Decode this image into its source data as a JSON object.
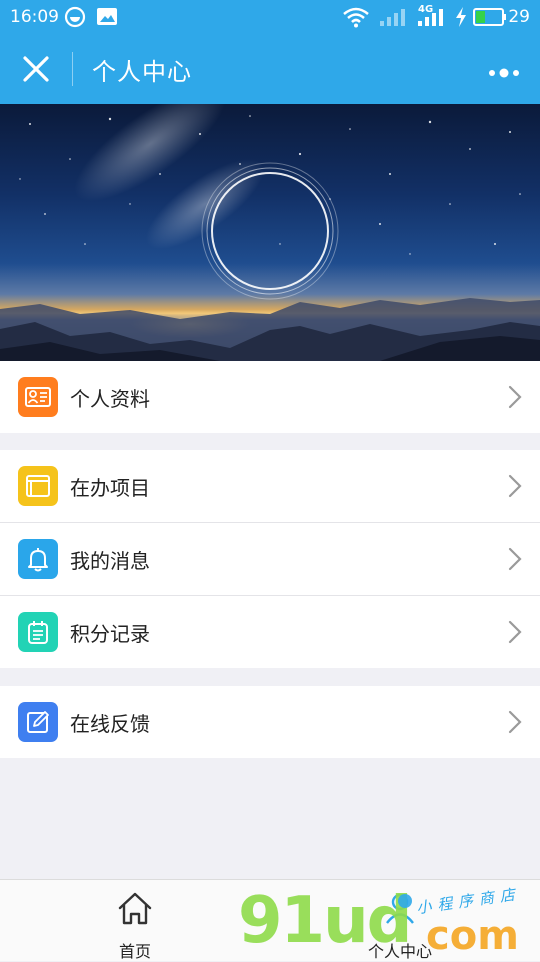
{
  "status_bar": {
    "time": "16:09",
    "network": "4G",
    "battery": "29"
  },
  "title_bar": {
    "title": "个人中心"
  },
  "menu": {
    "profile": {
      "label": "个人资料",
      "icon": "profile-card-icon",
      "color": "#ff7d1e"
    },
    "projects": {
      "label": "在办项目",
      "icon": "folder-icon",
      "color": "#f5c31b"
    },
    "messages": {
      "label": "我的消息",
      "icon": "bell-icon",
      "color": "#2aa6ea"
    },
    "points": {
      "label": "积分记录",
      "icon": "points-record-icon",
      "color": "#22d3b5"
    },
    "feedback": {
      "label": "在线反馈",
      "icon": "edit-icon",
      "color": "#3f7ff0"
    }
  },
  "tab_bar": {
    "home_label": "首页",
    "me_label": "个人中心"
  },
  "watermark": {
    "brand": "91ud",
    "domain": "com",
    "tagline": "小程序商店"
  }
}
